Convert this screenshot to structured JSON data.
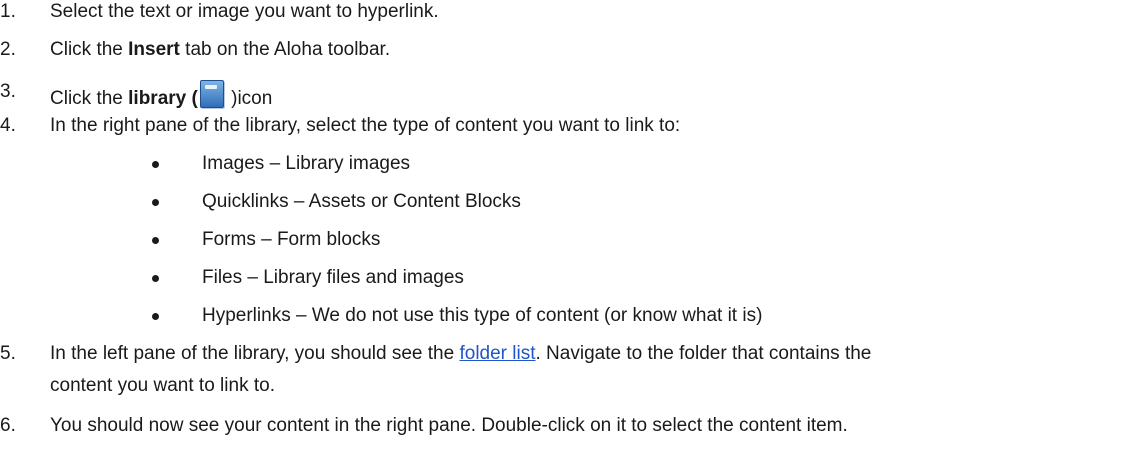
{
  "steps": [
    {
      "num": "1.",
      "text": "Select the text or image you want to hyperlink."
    },
    {
      "num": "2.",
      "pre": "Click the ",
      "bold": "Insert",
      "post": " tab on the Aloha toolbar."
    },
    {
      "num": "3.",
      "pre": "Click the ",
      "bold": "library (",
      "post": " )icon",
      "icon": "library-book-icon"
    },
    {
      "num": "4.",
      "text": "In the right pane of the library, select the type of content you want to link to:"
    },
    {
      "num": "5.",
      "pre": "In the left pane of the library, you should see the ",
      "link": "folder list",
      "post": ". Navigate to the folder that contains the",
      "cont": "content you want to link to."
    },
    {
      "num": "6.",
      "text": "You should now see your content in the right pane. Double-click on it to select the content item."
    }
  ],
  "content_types": [
    "Images – Library images",
    "Quicklinks – Assets or Content Blocks",
    "Forms – Form blocks",
    "Files – Library files and images",
    "Hyperlinks – We do not use this type of content (or know what it is)"
  ]
}
